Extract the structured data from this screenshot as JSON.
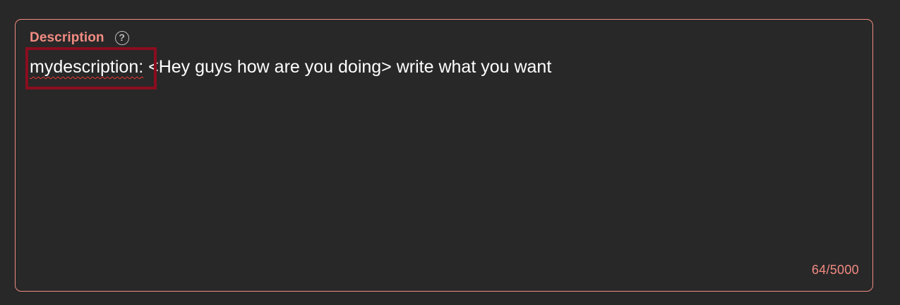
{
  "description_field": {
    "label": "Description",
    "help_icon": "question-circle-icon",
    "help_glyph": "?",
    "value_flagged_word": "mydescription:",
    "value_rest": " <Hey guys how are you doing> write what you want",
    "char_counter": "64/5000"
  },
  "colors": {
    "accent": "#f28b82",
    "background": "#282828",
    "text": "#ffffff",
    "highlight_box": "#8b0d1f",
    "spellcheck_underline": "#e53935"
  }
}
